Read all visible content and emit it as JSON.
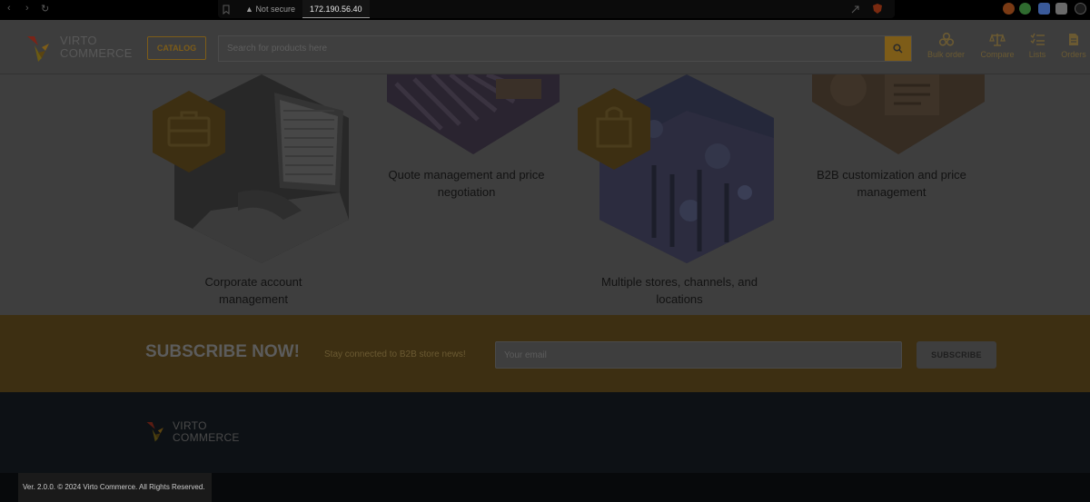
{
  "browser": {
    "security_label": "Not secure",
    "url": "172.190.56.40"
  },
  "header": {
    "logo_line1": "VIRTO",
    "logo_line2": "COMMERCE",
    "catalog_label": "CATALOG",
    "search_placeholder": "Search for products here",
    "actions": {
      "bulk_order": "Bulk order",
      "compare": "Compare",
      "lists": "Lists",
      "orders": "Orders"
    }
  },
  "features": {
    "corporate": "Corporate account management",
    "quote": "Quote management and price negotiation",
    "stores": "Multiple stores, channels, and locations",
    "customization": "B2B customization and price management"
  },
  "subscribe": {
    "title": "SUBSCRIBE NOW!",
    "subtitle": "Stay connected to B2B store news!",
    "email_placeholder": "Your email",
    "button_label": "SUBSCRIBE"
  },
  "footer": {
    "logo_line1": "VIRTO",
    "logo_line2": "COMMERCE",
    "copyright": "Ver. 2.0.0. © 2024 Virto Commerce. All Rights Reserved."
  },
  "colors": {
    "accent_dimmed": "#7d5c18",
    "overlay_dark": "#3e3e3e",
    "footer_bg": "#0d1115"
  }
}
